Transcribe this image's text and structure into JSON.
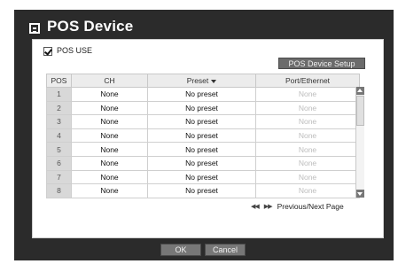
{
  "window": {
    "title": "POS Device"
  },
  "pos_use": {
    "label": "POS USE",
    "checked": true
  },
  "setup_button": {
    "label": "POS Device Setup"
  },
  "table": {
    "headers": {
      "pos": "POS",
      "ch": "CH",
      "preset": "Preset",
      "port": "Port/Ethernet"
    },
    "rows": [
      {
        "pos": "1",
        "ch": "None",
        "preset": "No preset",
        "port": "None"
      },
      {
        "pos": "2",
        "ch": "None",
        "preset": "No preset",
        "port": "None"
      },
      {
        "pos": "3",
        "ch": "None",
        "preset": "No preset",
        "port": "None"
      },
      {
        "pos": "4",
        "ch": "None",
        "preset": "No preset",
        "port": "None"
      },
      {
        "pos": "5",
        "ch": "None",
        "preset": "No preset",
        "port": "None"
      },
      {
        "pos": "6",
        "ch": "None",
        "preset": "No preset",
        "port": "None"
      },
      {
        "pos": "7",
        "ch": "None",
        "preset": "No preset",
        "port": "None"
      },
      {
        "pos": "8",
        "ch": "None",
        "preset": "No preset",
        "port": "None"
      }
    ]
  },
  "pagination": {
    "label": "Previous/Next Page",
    "prev_icon": "rewind-icon",
    "next_icon": "fast-forward-icon"
  },
  "footer": {
    "ok_label": "OK",
    "cancel_label": "Cancel"
  }
}
